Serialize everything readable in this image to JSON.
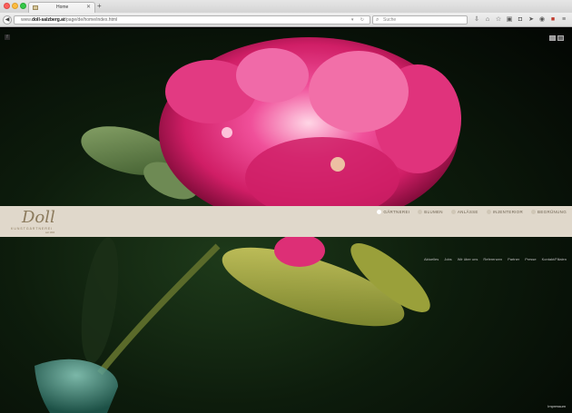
{
  "browser": {
    "tab_title": "Home",
    "new_tab": "+",
    "url_domain": "doll-salzberg.at",
    "url_prefix": "www.",
    "url_path": "/page/de/home/index.html",
    "search_placeholder": "Suche"
  },
  "page": {
    "logo_text": "Doll",
    "logo_subtitle": "KUNSTGÄRTNEREI",
    "logo_year": "seit 1904",
    "main_nav": [
      {
        "label": "GÄRTNEREI",
        "active": true
      },
      {
        "label": "BLUMEN"
      },
      {
        "label": "ANLÄSSE"
      },
      {
        "label": "INJENTERIOR"
      },
      {
        "label": "BEGRÜNUNG"
      }
    ],
    "sub_nav": [
      "Aktuelles",
      "Jobs",
      "Wir über uns",
      "Referenzen",
      "Partner",
      "Presse",
      "Kontakt/Filialen"
    ],
    "footer_link": "Impressum",
    "social": "f"
  },
  "colors": {
    "band": "#e0d8cb",
    "brand": "#8b7a5c",
    "flower": "#e8347a"
  }
}
